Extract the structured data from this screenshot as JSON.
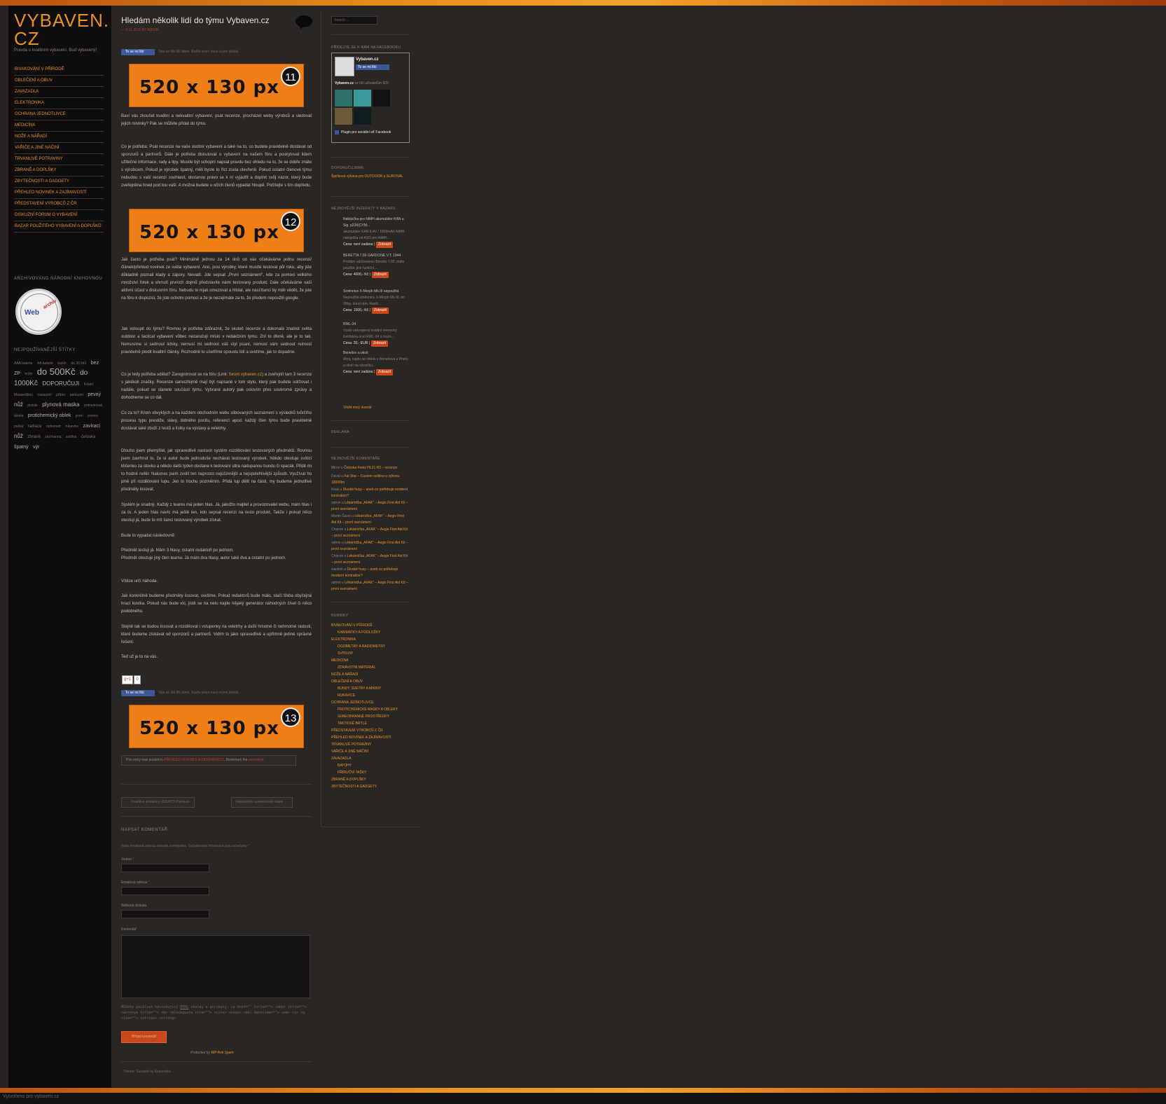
{
  "site": {
    "title_line1": "VYBAVEN.",
    "title_line2": "CZ",
    "tagline": "Pravda o kvalitním vybavení. Buď vybavený!"
  },
  "nav": [
    "BIVAKOVÁNÍ V PŘÍRODĚ",
    "OBLEČENÍ A OBUV",
    "ZAVAZADLA",
    "ELEKTRONIKA",
    "OCHRANA JEDNOTLIVCE",
    "MEDICÍNA",
    "NOŽE A NÁŘADÍ",
    "VAŘIČE A JINÉ NÁČINÍ",
    "TRVANLIVÉ POTRAVINY",
    "ZBRANĚ A DOPLŇKY",
    "ZBYTEČNOSTI A GADGETY",
    "PŘEHLED NOVINEK A ZAJÍMAVOSTÍ",
    "PŘEDSTAVENÍ VÝROBCŮ Z ČR",
    "DISKUZNÍ FÓRUM O VYBAVENÍ",
    "BAZAR POUŽITÉHO VYBAVENÍ A DOPLŇKŮ"
  ],
  "left_widgets": {
    "archive_heading": "ARCHIVOVÁNO NÁRODNÍ KNIHOVNOU",
    "seal_web": "Web",
    "seal_arch": "archiv",
    "tags_heading": "NEJPOUŽÍVANĚJŠÍ ŠTÍTKY",
    "tags": [
      {
        "t": "AAA baterie",
        "s": 5
      },
      {
        "t": "AA baterie",
        "s": 5
      },
      {
        "t": "batoh",
        "s": 5
      },
      {
        "t": "do 30 litrů",
        "s": 5
      },
      {
        "t": "bez",
        "s": 7
      },
      {
        "t": "ZP",
        "s": 7
      },
      {
        "t": "brýle",
        "s": 5
      },
      {
        "t": "do 500Kč",
        "s": 13
      },
      {
        "t": "do",
        "s": 10
      },
      {
        "t": "1000Kč",
        "s": 10
      },
      {
        "t": "DOPORUČUJI",
        "s": 8
      },
      {
        "t": "fixbert",
        "s": 5
      },
      {
        "t": "Maxpedition",
        "s": 5
      },
      {
        "t": "nasazení",
        "s": 5
      },
      {
        "t": "příbor",
        "s": 5
      },
      {
        "t": "perkusní",
        "s": 5
      },
      {
        "t": "pevný",
        "s": 7
      },
      {
        "t": "nůž",
        "s": 8
      },
      {
        "t": "pistole",
        "s": 5
      },
      {
        "t": "plynová maska",
        "s": 8
      },
      {
        "t": "potravinová dávka",
        "s": 5
      },
      {
        "t": "protichemický oblek",
        "s": 7
      },
      {
        "t": "první",
        "s": 5
      },
      {
        "t": "pomoc",
        "s": 5
      },
      {
        "t": "puška",
        "s": 5
      },
      {
        "t": "radiace",
        "s": 6
      },
      {
        "t": "radiometr",
        "s": 5
      },
      {
        "t": "rukavice",
        "s": 5
      },
      {
        "t": "zavírací",
        "s": 7
      },
      {
        "t": "nůž",
        "s": 8
      },
      {
        "t": "zbraně",
        "s": 6
      },
      {
        "t": "záchranná",
        "s": 5
      },
      {
        "t": "svítilna",
        "s": 5
      },
      {
        "t": "čelovka",
        "s": 6
      },
      {
        "t": "špatný",
        "s": 7
      },
      {
        "t": "výr",
        "s": 7
      }
    ]
  },
  "post": {
    "title": "Hledám několik lidí do týmu Vybaven.cz",
    "meta": "— 9.11.2015 BY ADMIN",
    "like_label": "To se mi líbí",
    "like_text": "Toto se líbí 86 lidem. Buďte první mezi svými přáteli.",
    "banners": [
      {
        "txt": "520 x 130 px",
        "num": "11"
      },
      {
        "txt": "520 x 130 px",
        "num": "12"
      },
      {
        "txt": "520 x 130 px",
        "num": "13"
      }
    ],
    "p1": "Baví vás zkoušet kvalitní a nekvalitní vybavení, psát recenze, procházet weby výrobců a sledovat jejich novinky? Pak se můžete přidat do týmu.",
    "p2": "Co je potřeba: Psát recenze na vaše osobní vybavení a také na to, co budete pravidelně dostávat od sponzorů a partnerů. Dále je potřeba diskutovat o vybavení na našem fóru a poskytovat lidem užitečné informace, rady a tipy. Musíte být schopní napsat pravdu bez ohledu na to, že se dobře znáte s výrobcem. Pokud je výrobek špatný, měli byste to říct zcela otevřeně. Pokud ostatní členové týmu nebudou s vaší recenzí souhlasit, dostanou právo se k ní vyjádřit a doplnit svůj názor, který bude zveřejněna hned pod tou vaší. A možná budete u očích členů vypadat hloupě. Počítejte s tím dopředu.",
    "p3": "Jak často je potřeba psát? Minimálně jednou za 14 dnů od vás očekáváme jednu recenzi/článek/přehled novinek ze světa vybavení. Ano, jsou výrobky, které musíte testovat půl roku, aby jste důkladně poznali klady a zápory. Nevadí. Jde sepsat „První seznámení“, kde za pomoci velkého množství fotek a shrnutí prvních dojmů představíte námi testovaný produkt. Dále očekáváme vaší aktivní účast v diskusním fóru. Nebudu to nijak omezovat a hlídat, ale nasčítanci by měli vědět, že jste na fóru k dispozici, že jste ochotni pomoci a že je nezajímáte za to, že předem nepoužili google.",
    "p4": "Jak vstoupit do týmu? Rovnou je potřeba zdůraznit, že skuteč recenze a dokonalá znalost světa outdoor a tactical vybavení vůbec nezaručují místo v redakčním týmu. Zní to divně, ale je to tak. Nemusíme si sednout lidsky, nemusí mi sednout váš styl psaní, nemusí vám sednout nutnost pravidelně plodit kvalitní články. Rozhodně to ušetříme spoustu lidí a uvidíme, jak to dopadne.",
    "p5_a": "Co je tedy potřeba udělat? Zaregistrovat se na fóru (Link: ",
    "p5_link": "forum.vybaven.cz",
    "p5_b": ") a zveřejnit tam 3 recenze s jakékoli značky. Recenze samozřejmě mají být napsané v tom stylu, který pak budete udržovat i nadále, pokud se stanete součástí týmu. Vybrané autory pak oslovím přes soukromé zprávy a dohodneme se co dál.",
    "p6": "Co za to? Krom obvyklých a na každém obchodním webu slibovaných seznámení s výsledků tvůrčího procesu typu prestiže, slávy, dobrého pocitu, referencí apod. každý člen týmu bude pravidelně dostávat také zboží z testů a lístky na výstavy a veletrhy.",
    "p7": "Dlouho jsem přemýšlel, jak spravedlivě nastavit systém rozdělování testovaných předmětů. Rovnou jsem zavrhnul to, že si autor bude jednoduše nechávat testovaný výrobek. Někdo otestuje svítící klíčenku za stovku a někdo další týden dostane k testování ultra nadupanou bundu či spacák. Přidě mi to hodně nefér. Nakonec jsem zvolil ten naprosto nejúčinnější a nejspolehlivější způsob. Využívat ho plně při rozdělování lupu. Jen to trochu pozměním. Přidá lup dělit na části, my budeme jednotlivé předměty losovat.",
    "p8": "Systém je snadný. Každý z teamu má jeden hlas. Já, jakožto majitel a provozovatel webu, mám hlas i za to. A jeden hlas navíc má ještě ten, kdo sepsal recenzi na testo produkt. Takže i pokud něco otestuji já, bude to mít šanci testovaný výrobek získat.",
    "p9": "Bude to vypadat následovně:",
    "p10": "Předmět testuji já. Mám 3 hlasy, ostatní redaktoři po jednom.",
    "p11": "Předmět otestuje jiný člen teamu. Já mám dva hlasy, autor také dva a ostatní po jednom.",
    "p12": "Vítěze určí náhoda.",
    "p13": "Jak konkrétně budeme předměty losovat, uvidíme. Pokud redaktorů bude málo, stačí třeba obyčejná hrací kostka. Pokud nás bude víc, jistě se na netu najde nějaký generátor náhodných čísel či něco podobného.",
    "p14": "Stejně tak se budou losovat a rozdělovat i vstupenky na veletrhy a další hmotné či nehmotné radosti, které budeme získávat od sponzorů a partnerů. Vidím to jako spravedlivé a upřímně jediné správné řešení.",
    "p15": "Teď už je to na vás.",
    "share_g": "g+1",
    "share_n": "0",
    "entry_pre": "This entry was posted in ",
    "entry_cat": "PŘEHLED NOVINEK A ZAJÍMAVOSTÍ",
    "entry_mid": ". Bookmark the ",
    "entry_link": "permalink",
    "entry_end": ".",
    "prev": "← Trvanlivé potraviny LEGACY Premium",
    "next": "Nejnutnější společenský oblek →"
  },
  "comment_form": {
    "heading": "NAPSAT KOMENTÁŘ",
    "note": "Vaše emailová adresa nebude zveřejněna. Vyžadované informace jsou označeny *",
    "name_label": "Jméno",
    "email_label": "Emailová adresa",
    "web_label": "Webová stránka",
    "comment_label": "Komentář",
    "req": "*",
    "allowed_prefix": "Můžete používat následující ",
    "allowed_html": "HTML",
    "allowed_suffix": " značky a atributy: <a href=\"\" title=\"\"> <abbr title=\"\"> <acronym title=\"\"> <b> <blockquote cite=\"\"> <cite> <code> <del datetime=\"\"> <em> <i> <q cite=\"\"> <strike> <strong>",
    "submit": "Přidat komentář",
    "protected_by": "Protected by ",
    "protected_name": "WP Anti Spam"
  },
  "theme_footer": "Theme: Sunspot by Automattic.",
  "footer_strip": "Vytvořeno pro vybaven.cz",
  "right": {
    "search_placeholder": "Search ...",
    "fb_heading": "PŘIDEJTE SE K NÁM NA FACEBOOKU",
    "fb_name": "Vybaven.cz",
    "fb_like": "To se mi líbí",
    "fb_fans_name": "Vybaven.cz",
    "fb_fans_text": " se líbí uživatelům 826",
    "fb_plugin": "Plugin pro sociální síť Facebook",
    "recommend_heading": "DOPORUČUJEME:",
    "recommend_link": "Špičková výbava pro OUTDOOR a SURVIVAL",
    "bazar_heading": "NEJNOVĚJŠÍ INZERÁTY V BAZARU",
    "bazar": [
      {
        "t": "Nabíječka pro NiMH akumulátor KAN a Sig. p226(CYM...",
        "d": "akumulátor KAN 8.4V / 1800mAh NiMH nabíječka od ASG pro NiMH...",
        "p": "Cena: není zadána |",
        "b": "Zobrazit"
      },
      {
        "t": "BERETTA 7,65 GARDONE V.T. 1944",
        "d": "Prodám udržovanou Berettu 7,65 ,málo použitá ,jiné funkční...",
        "p": "Cena: 4000,- Kč |",
        "b": "Zobrazit"
      },
      {
        "t": "Směnnice X-Morph Mk.III nepoužitá",
        "d": "Nepoužitá směnnice X-Morph Mk.III, do 90kg, dural rám, klasik...",
        "p": "Cena: 1500,- Kč |",
        "b": "Zobrazit"
      },
      {
        "t": "RWL-34",
        "d": "Vzato zakoupený kvalitní nerezový švédskou ocel RWL-34 a nozm...",
        "p": "Cena: 20,- EUR |",
        "b": "Zobrazit"
      },
      {
        "t": "Benešov a okolí",
        "d": "Ahoj, najdu se někdo z Benešova u Prahy a okolí na výcvičku...",
        "p": "Cena: není zadána |",
        "b": "Zobrazit"
      }
    ],
    "bazar_new": "Vložit nový inzerát",
    "reklama": "REKLAMA",
    "rc_heading": "NEJNOVĚJŠÍ KOMENTÁŘE",
    "rc": [
      {
        "a": "Miron",
        "t": "Čelovka Fenix HL21 R3 – recenze"
      },
      {
        "a": "David",
        "t": "Fat Star – Custom svítilna o výkonu 18000lm"
      },
      {
        "a": "Kitak",
        "t": "Divoké husy – aneb co potřebuje moderní kontraktor?"
      },
      {
        "a": "admin",
        "t": "Lékárnička „AFAK“ – Aegis First Aid Kit – první seznámení"
      },
      {
        "a": "Martin Šavel",
        "t": "Lékárnička „AFAK“ – Aegis First Aid Kit – první seznámení"
      },
      {
        "a": "Charvin",
        "t": "Lékárnička „AFAK“ – Aegis First Aid Kit – první seznámení"
      },
      {
        "a": "admin",
        "t": "Lékárnička „AFAK“ – Aegis First Aid Kit – první seznámení"
      },
      {
        "a": "Charvin",
        "t": "Lékárnička „AFAK“ – Aegis First Aid Kit – první seznámení"
      },
      {
        "a": "wackoh",
        "t": "Divoké husy – aneb co potřebuje moderní kontraktor?"
      },
      {
        "a": "admin",
        "t": "Lékárnička „AFAK“ – Aegis First Aid Kit – první seznámení"
      }
    ],
    "rc_sep": " u ",
    "cats_heading": "RUBRIKY",
    "cats": [
      {
        "t": "BIVAKOVÁNÍ V PŘÍRODĚ",
        "sub": false
      },
      {
        "t": "KARIMATKY A PODLOŽKY",
        "sub": true
      },
      {
        "t": "ELEKTRONIKA",
        "sub": false
      },
      {
        "t": "DOZIMETRY A RADIOMETRY",
        "sub": true
      },
      {
        "t": "SVÍTILNY",
        "sub": true
      },
      {
        "t": "MEDICÍNA",
        "sub": false
      },
      {
        "t": "ZDRAVOTNÍ MATERIÁL",
        "sub": true
      },
      {
        "t": "NOŽE A NÁŘADÍ",
        "sub": false
      },
      {
        "t": "OBLEČENÍ A OBUV",
        "sub": false
      },
      {
        "t": "BUNDY, SVETRY A MIKINY",
        "sub": true
      },
      {
        "t": "RUKAVICE",
        "sub": true
      },
      {
        "t": "OCHRANA JEDNOTLIVCE",
        "sub": false
      },
      {
        "t": "PROTICHEMICKÉ MASKY A OBLEKY",
        "sub": true
      },
      {
        "t": "SEBEOBRANNÉ PROSTŘEDKY",
        "sub": true
      },
      {
        "t": "TAKTICKÉ BRÝLE",
        "sub": true
      },
      {
        "t": "PŘEDSTAVENÍ VÝROBCŮ Z ČR",
        "sub": false
      },
      {
        "t": "PŘEHLED NOVINEK A ZAJÍMAVOSTÍ",
        "sub": false
      },
      {
        "t": "TRVANLIVÉ POTRAVINY",
        "sub": false
      },
      {
        "t": "VAŘIČE A JINÉ NÁČINÍ",
        "sub": false
      },
      {
        "t": "ZAVAZADLA",
        "sub": false
      },
      {
        "t": "BATOHY",
        "sub": true
      },
      {
        "t": "PŘÍRUČNÍ TAŠKY",
        "sub": true
      },
      {
        "t": "ZBRANĚ A DOPLŇKY",
        "sub": false
      },
      {
        "t": "ZBYTEČNOSTI A GADGETY",
        "sub": false
      }
    ]
  }
}
